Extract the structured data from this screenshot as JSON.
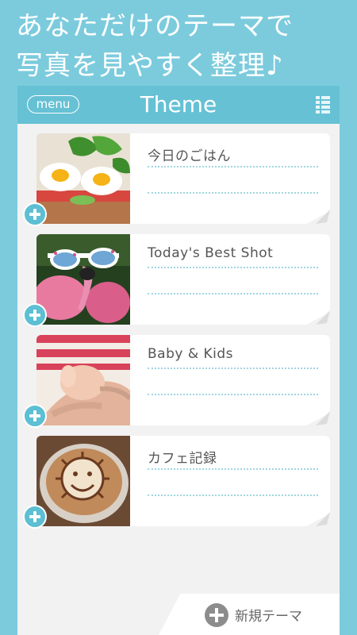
{
  "promo": {
    "line1": "あなただけのテーマで",
    "line2": "写真を見やすく整理♪"
  },
  "appbar": {
    "menu_label": "menu",
    "title": "Theme",
    "grid_icon": "list-grid-icon"
  },
  "themes": [
    {
      "title": "今日のごはん",
      "thumb": "food-sandwich-photo"
    },
    {
      "title": "Today's Best Shot",
      "thumb": "flamingo-sunglasses-photo"
    },
    {
      "title": "Baby & Kids",
      "thumb": "baby-hand-photo"
    },
    {
      "title": "カフェ記録",
      "thumb": "latte-art-photo"
    }
  ],
  "new_theme": {
    "label": "新規テーマ",
    "icon": "plus-circle-icon"
  },
  "colors": {
    "background": "#7ccbdd",
    "appbar": "#66c1d4",
    "accent": "#5cbfd3",
    "panel": "#f2f2f2"
  }
}
